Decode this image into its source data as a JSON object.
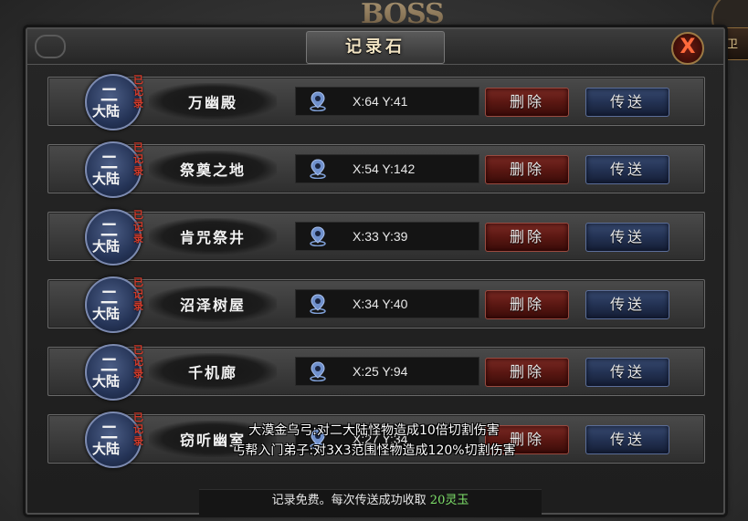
{
  "window": {
    "title": "记录石",
    "close_label": "X"
  },
  "background": {
    "boss_text": "BOSS",
    "side_button": "保卫"
  },
  "rows": [
    {
      "region_top": "二",
      "region_bottom": "大陆",
      "status": "已记录",
      "name": "万幽殿",
      "coord": "X:64 Y:41",
      "delete_label": "删除",
      "teleport_label": "传送"
    },
    {
      "region_top": "二",
      "region_bottom": "大陆",
      "status": "已记录",
      "name": "祭奠之地",
      "coord": "X:54 Y:142",
      "delete_label": "删除",
      "teleport_label": "传送"
    },
    {
      "region_top": "二",
      "region_bottom": "大陆",
      "status": "已记录",
      "name": "肯咒祭井",
      "coord": "X:33 Y:39",
      "delete_label": "删除",
      "teleport_label": "传送"
    },
    {
      "region_top": "二",
      "region_bottom": "大陆",
      "status": "已记录",
      "name": "沼泽树屋",
      "coord": "X:34 Y:40",
      "delete_label": "删除",
      "teleport_label": "传送"
    },
    {
      "region_top": "二",
      "region_bottom": "大陆",
      "status": "已记录",
      "name": "千机廊",
      "coord": "X:25 Y:94",
      "delete_label": "删除",
      "teleport_label": "传送"
    },
    {
      "region_top": "二",
      "region_bottom": "大陆",
      "status": "已记录",
      "name": "窃听幽室",
      "coord": "X:27 Y:34",
      "delete_label": "删除",
      "teleport_label": "传送"
    }
  ],
  "tooltip": {
    "line1": "大漠金乌弓:对二大陆怪物造成10倍切割伤害",
    "line2": "丐帮入门弟子:对3X3范围怪物造成120%切割伤害"
  },
  "footer": {
    "text": "记录免费。每次传送成功收取",
    "amount": "20灵玉"
  },
  "colors": {
    "delete_button": "#5a1712",
    "teleport_button": "#233253",
    "recorded_tag": "#d13a2a",
    "footer_amount": "#7fe36a"
  }
}
